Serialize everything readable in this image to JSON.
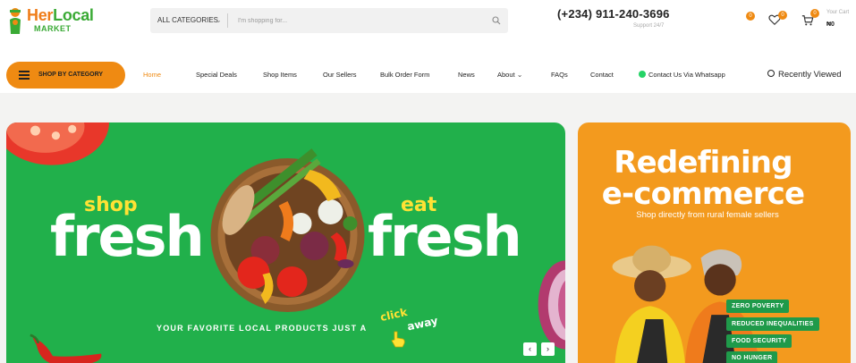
{
  "header": {
    "logo": {
      "brand_her": "Her",
      "brand_local": "Local",
      "brand_sub": "MARKET"
    },
    "search": {
      "category_label": "ALL CATEGORIES",
      "placeholder": "I'm shopping for..."
    },
    "phone": "(+234) 911-240-3696",
    "support": "Support 24/7",
    "compare_count": "0",
    "wishlist_count": "0",
    "cart_count": "0",
    "cart_label": "Your Cart",
    "cart_total": "₦0"
  },
  "nav": {
    "category_button": "SHOP BY CATEGORY",
    "items": [
      {
        "label": "Home",
        "active": true
      },
      {
        "label": "Special Deals"
      },
      {
        "label": "Shop Items"
      },
      {
        "label": "Our Sellers"
      },
      {
        "label": "Bulk Order Form"
      },
      {
        "label": "News"
      },
      {
        "label": "About"
      },
      {
        "label": "FAQs"
      },
      {
        "label": "Contact"
      },
      {
        "label": "Contact Us Via Whatsapp"
      }
    ],
    "recently_viewed": "Recently Viewed"
  },
  "hero": {
    "shop": "shop",
    "fresh_left": "fresh",
    "eat": "eat",
    "fresh_right": "fresh",
    "tagline": "YOUR FAVORITE LOCAL PRODUCTS JUST A",
    "click": "click",
    "away": "away",
    "prev": "‹",
    "next": "›"
  },
  "promo": {
    "title_line1": "Redefining",
    "title_line2": "e-commerce",
    "subtitle": "Shop directly from rural female sellers",
    "pills": [
      "ZERO POVERTY",
      "REDUCED INEQUALITIES",
      "FOOD SECURITY",
      "NO HUNGER"
    ]
  },
  "colors": {
    "brand_orange": "#ef8a12",
    "brand_green": "#21b04b",
    "promo_orange": "#f39a1e",
    "tag_yellow": "#ffe234"
  }
}
